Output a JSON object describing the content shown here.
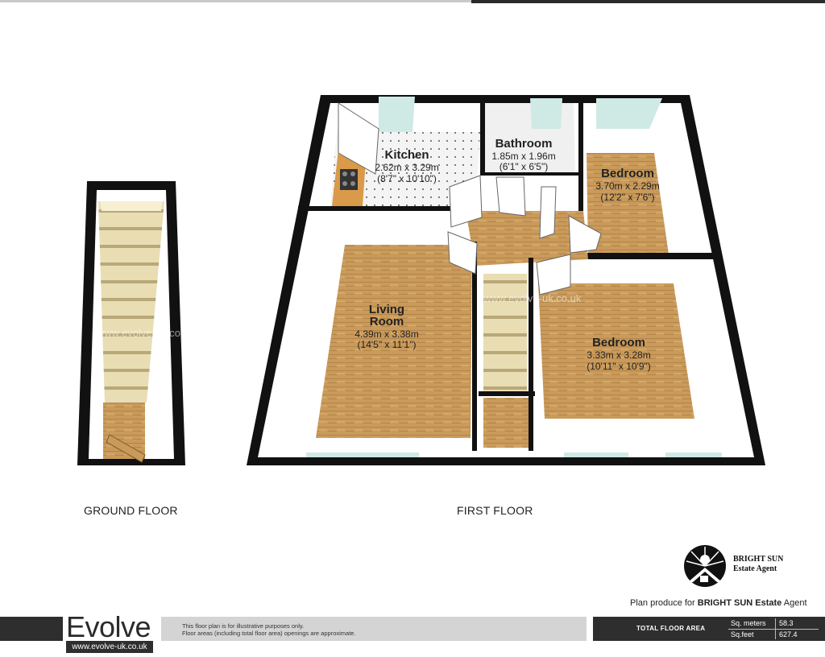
{
  "floors": [
    {
      "label": "GROUND FLOOR"
    },
    {
      "label": "FIRST FLOOR"
    }
  ],
  "rooms": [
    {
      "name": "Kitchen",
      "metric": "2.62m x 3.29m",
      "imperial": "(8'7\" x 10'10\")"
    },
    {
      "name": "Bathroom",
      "metric": "1.85m x 1.96m",
      "imperial": "(6'1\" x 6'5\")"
    },
    {
      "name": "Bedroom",
      "metric": "3.70m x 2.29m",
      "imperial": "(12'2\" x 7'6\")"
    },
    {
      "name_line1": "Living",
      "name_line2": "Room",
      "metric": "4.39m x 3.38m",
      "imperial": "(14'5\" x 11'1\")"
    },
    {
      "name": "Bedroom",
      "metric": "3.33m x 3.28m",
      "imperial": "(10'11\" x 10'9\")"
    }
  ],
  "watermark": "www.evolve-uk.co.uk",
  "agent": {
    "line1": "BRIGHT SUN",
    "line2": "Estate Agent",
    "credit_prefix": "Plan produce for",
    "credit_name": "BRIGHT SUN Estate",
    "credit_suffix": "Agent"
  },
  "footer": {
    "brand": "Evolve",
    "url": "www.evolve-uk.co.uk",
    "disclaimer_line1": "This floor plan is for illustrative purposes only.",
    "disclaimer_line2": "Floor areas (including total floor area) openings are approximate.",
    "total_label": "TOTAL FLOOR AREA",
    "sqm_label": "Sq. meters",
    "sqm_value": "58.3",
    "sqft_label": "Sq.feet",
    "sqft_value": "627.4"
  },
  "colors": {
    "wall": "#111111",
    "floor_wood": "#c99a5a",
    "stairs": "#e8dcb0",
    "kitchen_tile": "#f2f2f2",
    "footer_dark": "#2e2e2e"
  }
}
